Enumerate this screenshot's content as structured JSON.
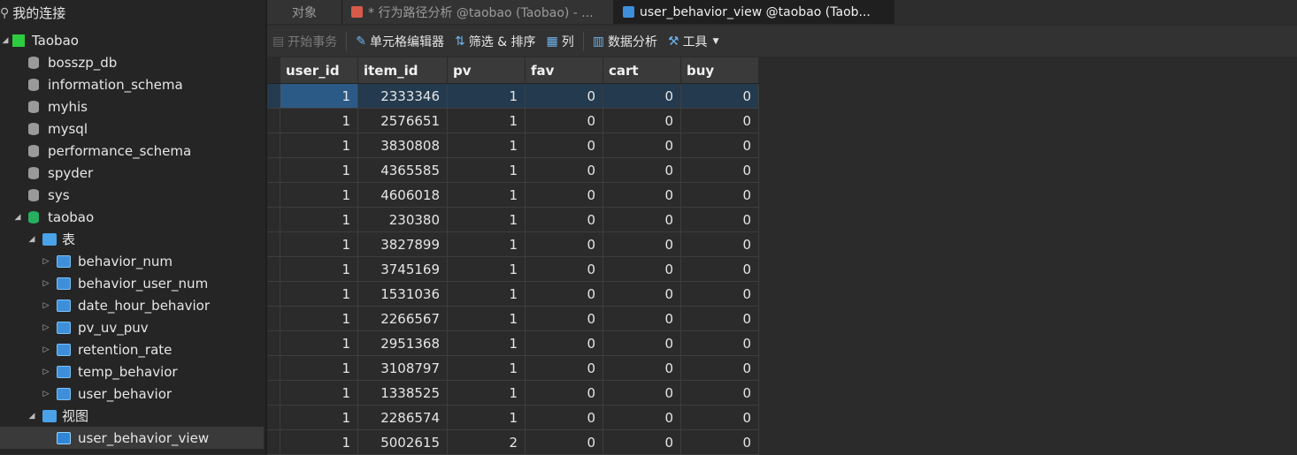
{
  "sidebar": {
    "header": "我的连接",
    "connection": "Taobao",
    "databases": [
      "bosszp_db",
      "information_schema",
      "myhis",
      "mysql",
      "performance_schema",
      "spyder",
      "sys"
    ],
    "active_db": "taobao",
    "tables_folder": "表",
    "tables": [
      "behavior_num",
      "behavior_user_num",
      "date_hour_behavior",
      "pv_uv_puv",
      "retention_rate",
      "temp_behavior",
      "user_behavior"
    ],
    "views_folder": "视图",
    "views": [
      "user_behavior_view"
    ]
  },
  "tabs": [
    {
      "label": "对象"
    },
    {
      "label": "* 行为路径分析 @taobao (Taobao) - ..."
    },
    {
      "label": "user_behavior_view @taobao (Taob..."
    }
  ],
  "toolbar": {
    "begin_tx": "开始事务",
    "cell_edit": "单元格编辑器",
    "filter_sort": "筛选 & 排序",
    "columns": "列",
    "data_analysis": "数据分析",
    "tools": "工具"
  },
  "grid": {
    "columns": [
      "user_id",
      "item_id",
      "pv",
      "fav",
      "cart",
      "buy"
    ],
    "rows": [
      [
        "1",
        "2333346",
        "1",
        "0",
        "0",
        "0"
      ],
      [
        "1",
        "2576651",
        "1",
        "0",
        "0",
        "0"
      ],
      [
        "1",
        "3830808",
        "1",
        "0",
        "0",
        "0"
      ],
      [
        "1",
        "4365585",
        "1",
        "0",
        "0",
        "0"
      ],
      [
        "1",
        "4606018",
        "1",
        "0",
        "0",
        "0"
      ],
      [
        "1",
        "230380",
        "1",
        "0",
        "0",
        "0"
      ],
      [
        "1",
        "3827899",
        "1",
        "0",
        "0",
        "0"
      ],
      [
        "1",
        "3745169",
        "1",
        "0",
        "0",
        "0"
      ],
      [
        "1",
        "1531036",
        "1",
        "0",
        "0",
        "0"
      ],
      [
        "1",
        "2266567",
        "1",
        "0",
        "0",
        "0"
      ],
      [
        "1",
        "2951368",
        "1",
        "0",
        "0",
        "0"
      ],
      [
        "1",
        "3108797",
        "1",
        "0",
        "0",
        "0"
      ],
      [
        "1",
        "1338525",
        "1",
        "0",
        "0",
        "0"
      ],
      [
        "1",
        "2286574",
        "1",
        "0",
        "0",
        "0"
      ],
      [
        "1",
        "5002615",
        "2",
        "0",
        "0",
        "0"
      ]
    ]
  },
  "colors": {
    "accent": "#2c5a86",
    "connection_icon": "#2ecc40",
    "active_db_icon": "#27ae60"
  }
}
